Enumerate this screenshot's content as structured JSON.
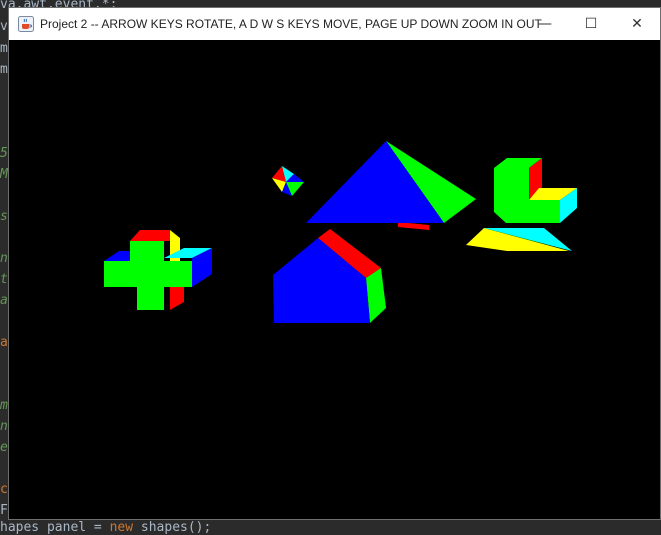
{
  "editor": {
    "top_line": "va.awt.event.*;",
    "gutter_chars": [
      "v",
      "m",
      "m",
      "5",
      "M",
      "s",
      "n",
      "t",
      "a",
      "a",
      "m",
      "n",
      "e",
      "c",
      "F"
    ],
    "right_chars": [
      "o",
      "E"
    ],
    "bottom_line_a": "hapes panel = ",
    "bottom_line_kw": "new",
    "bottom_line_b": " shapes();"
  },
  "window": {
    "title": "Project 2 -- ARROW KEYS ROTATE, A D W S KEYS MOVE, PAGE UP DOWN ZOOM IN OUT",
    "icon": "java-cup-icon",
    "controls": {
      "minimize": "—",
      "maximize": "☐",
      "close": "✕"
    }
  },
  "scene": {
    "background": "#000000",
    "face_colors": [
      "#0000ff",
      "#00ff00",
      "#ff0000",
      "#ffff00",
      "#00ffff"
    ],
    "shapes": [
      "plus-shape",
      "small-octahedron",
      "pyramid",
      "house-prism",
      "l-block",
      "flat-wedge"
    ]
  }
}
